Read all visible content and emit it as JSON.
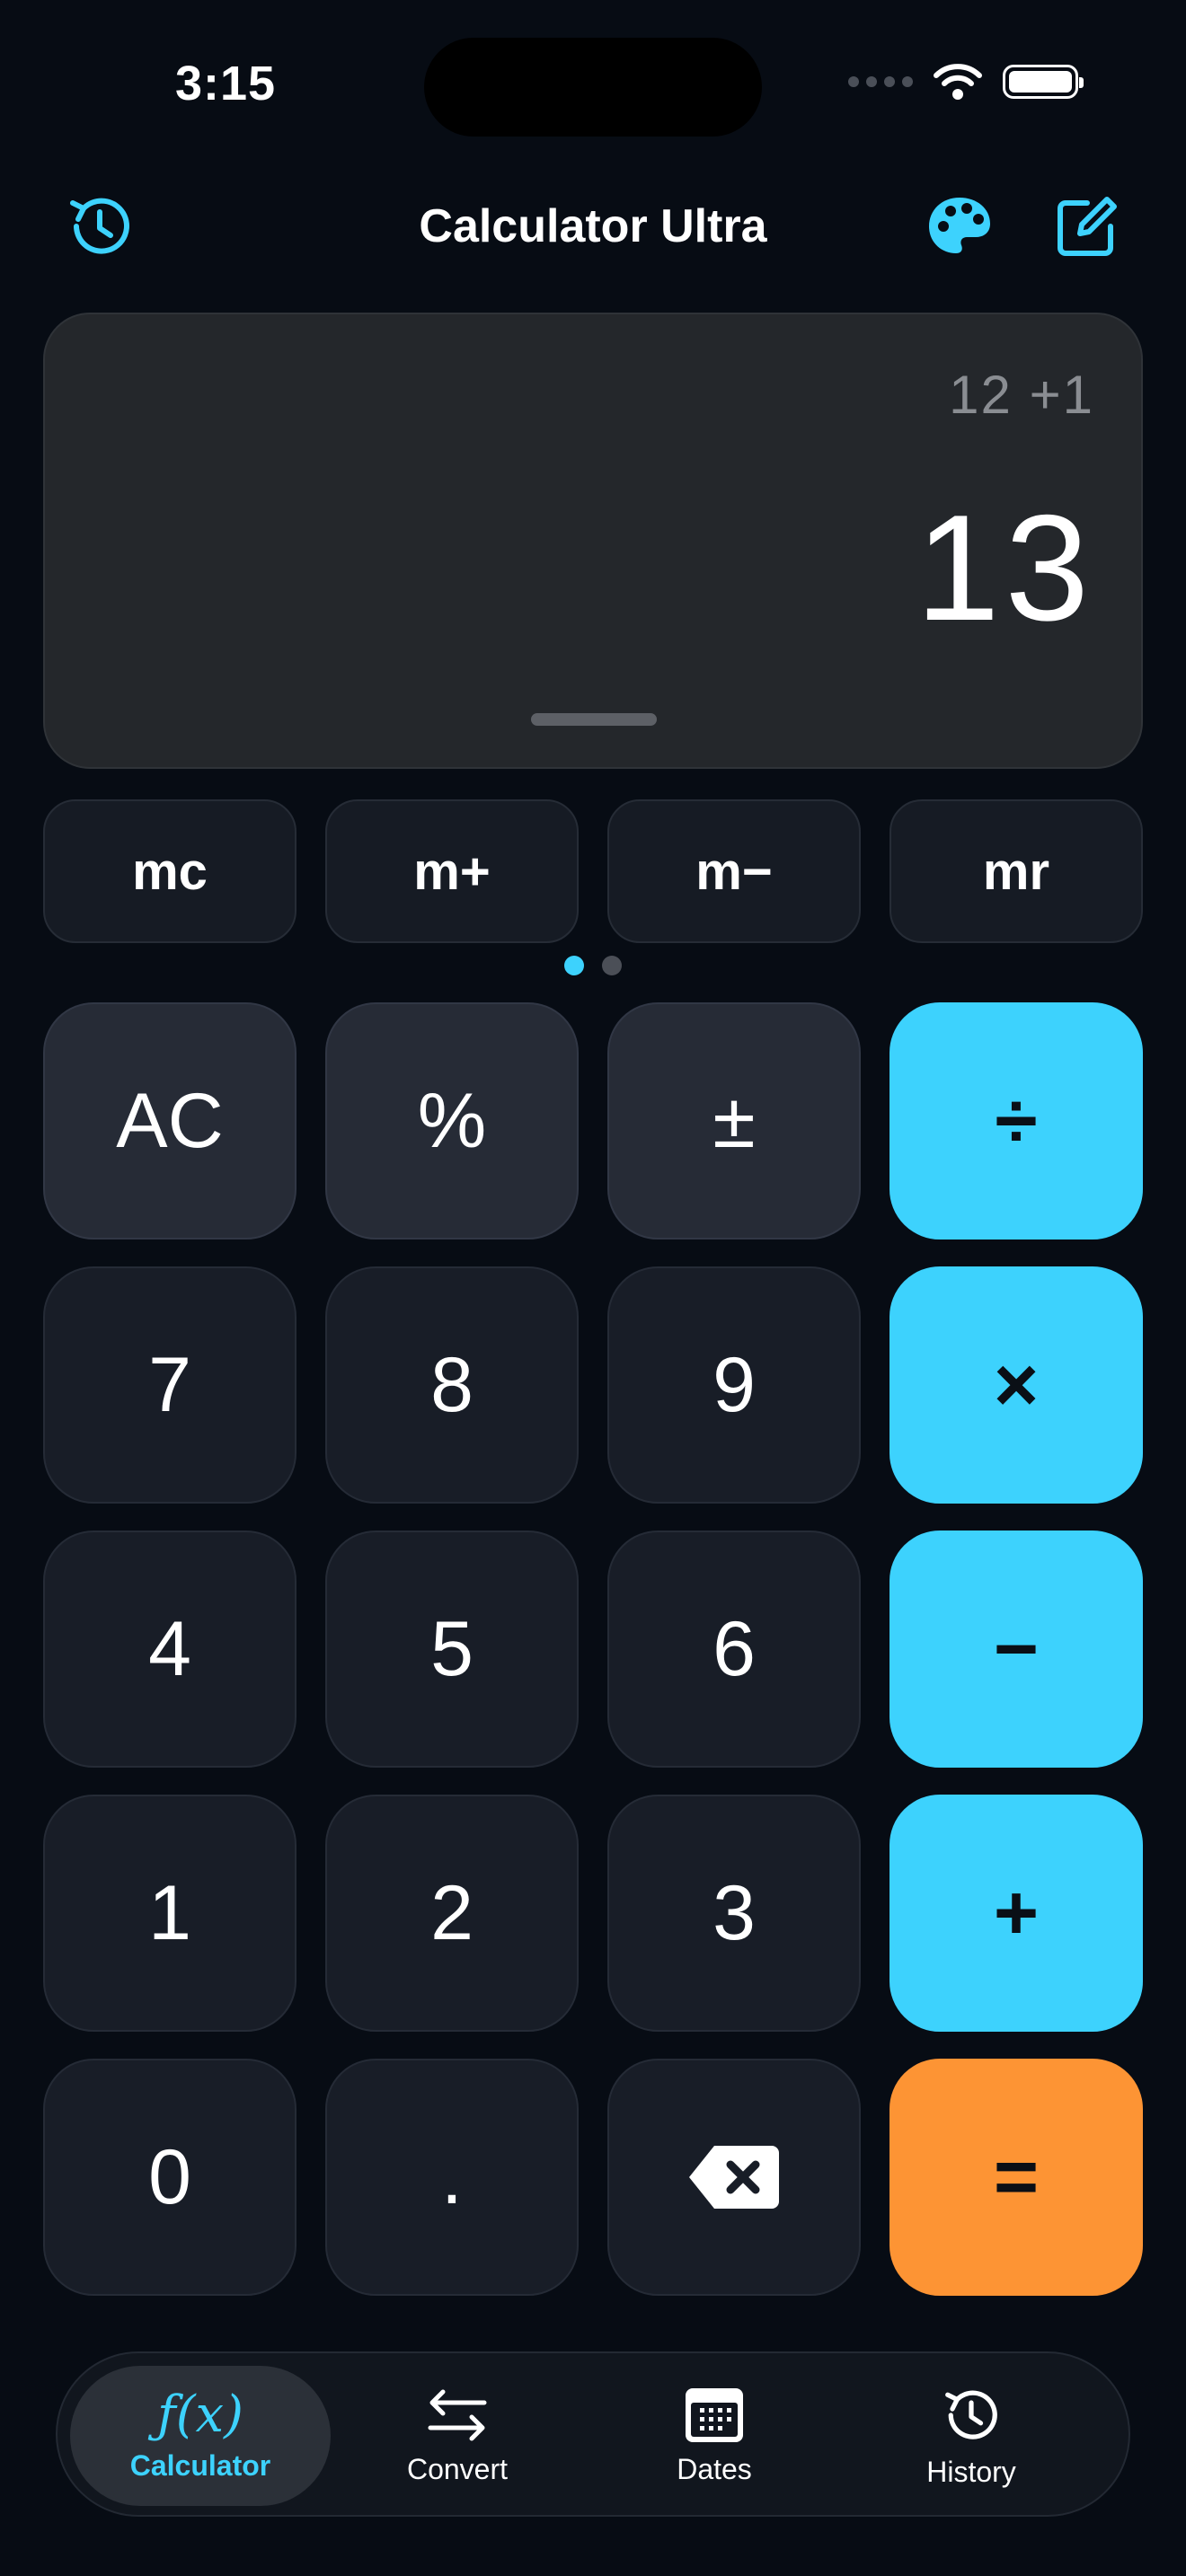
{
  "status_bar": {
    "time": "3:15"
  },
  "header": {
    "title": "Calculator Ultra",
    "left_icon": "history-icon",
    "right_icons": [
      "palette-icon",
      "edit-icon"
    ]
  },
  "display": {
    "expression": "12 +1",
    "result": "13"
  },
  "memory": [
    "mc",
    "m+",
    "m−",
    "mr"
  ],
  "page_indicator": {
    "count": 2,
    "active": 0
  },
  "keys": {
    "ac": "AC",
    "percent": "%",
    "sign": "±",
    "divide": "÷",
    "seven": "7",
    "eight": "8",
    "nine": "9",
    "multiply": "×",
    "four": "4",
    "five": "5",
    "six": "6",
    "minus": "−",
    "one": "1",
    "two": "2",
    "three": "3",
    "plus": "+",
    "zero": "0",
    "decimal": ".",
    "backspace": "backspace-icon",
    "equals": "="
  },
  "tabs": [
    {
      "label": "Calculator",
      "icon": "function-icon",
      "glyph": "ƒ(x)",
      "active": true
    },
    {
      "label": "Convert",
      "icon": "arrows-icon"
    },
    {
      "label": "Dates",
      "icon": "calendar-icon"
    },
    {
      "label": "History",
      "icon": "history-icon"
    }
  ],
  "colors": {
    "accent": "#3dd2fd",
    "equals": "#fd9434",
    "background": "#070c14"
  }
}
